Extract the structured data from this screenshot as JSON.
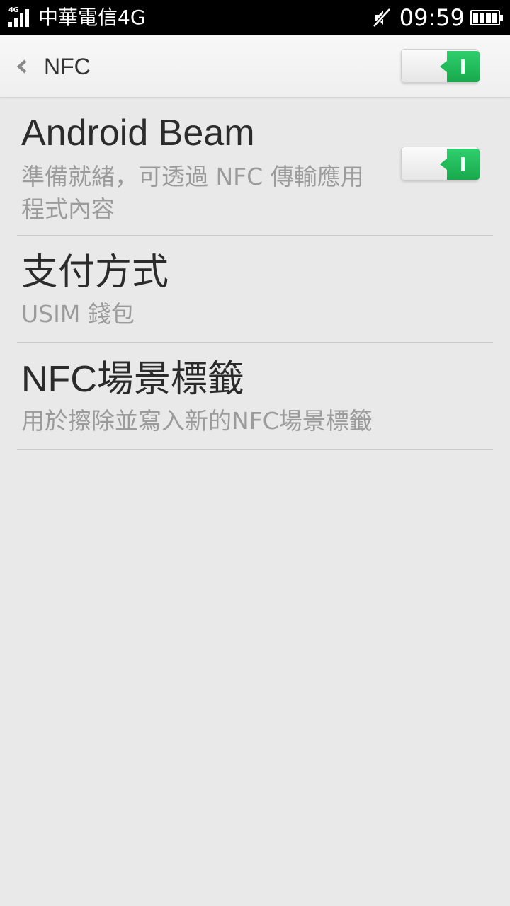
{
  "status_bar": {
    "network_tag": "4G",
    "carrier": "中華電信4G",
    "time": "09:59",
    "icons": [
      "signal-icon",
      "mute-icon",
      "battery-icon"
    ]
  },
  "header": {
    "back_icon": "chevron-left-icon",
    "title": "NFC",
    "nfc_enabled": true
  },
  "items": [
    {
      "title": "Android Beam",
      "subtitle": "準備就緒，可透過 NFC 傳輸應用程式內容",
      "toggle_on": true
    },
    {
      "title": "支付方式",
      "subtitle": "USIM 錢包"
    },
    {
      "title": "NFC場景標籤",
      "subtitle": "用於擦除並寫入新的NFC場景標籤"
    }
  ],
  "colors": {
    "accent": "#1fb85a",
    "background": "#e9e9e9",
    "status_bar": "#000000",
    "subtitle": "#9b9b9b"
  }
}
